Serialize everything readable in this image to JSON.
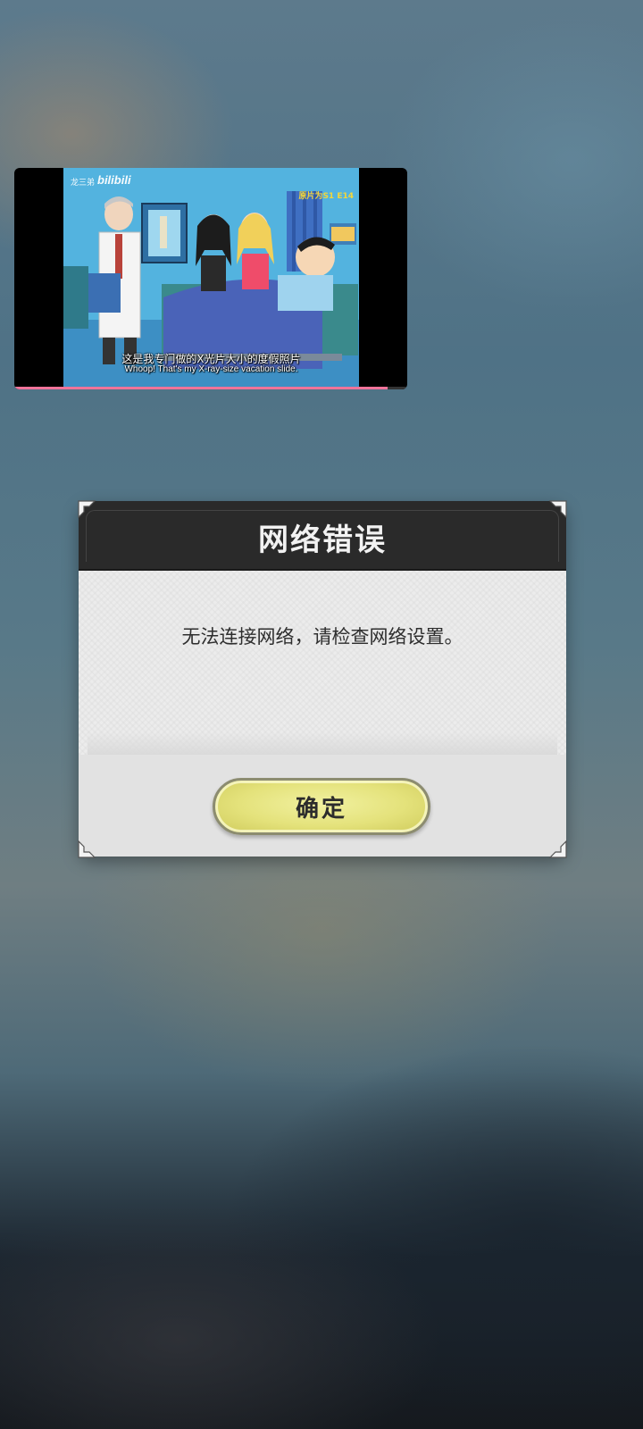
{
  "video_player": {
    "uploader": "龙三弟",
    "brand": "bilibili",
    "episode_tag": "原片为S1 E14",
    "subtitle_cn": "这是我专门做的X光片大小的度假照片",
    "subtitle_en": "Whoop! That's my X-ray-size vacation slide.",
    "progress_fraction": 0.95,
    "progress_color": "#f0739a"
  },
  "dialog": {
    "title": "网络错误",
    "message": "无法连接网络，请检查网络设置。",
    "confirm_label": "确定",
    "confirm_color": "#e4e27b"
  }
}
